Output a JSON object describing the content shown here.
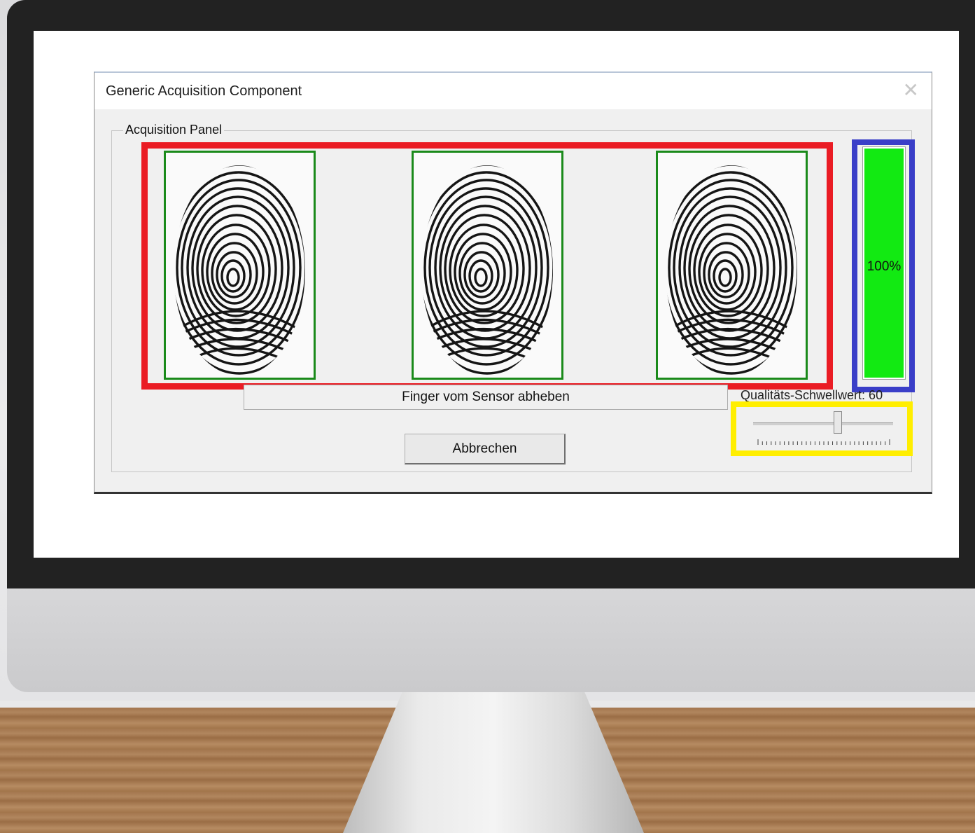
{
  "window": {
    "title": "Generic Acquisition Component",
    "close_icon": "close-icon"
  },
  "panel": {
    "label": "Acquisition Panel",
    "images": [
      {
        "name": "fingerprint-image-1",
        "icon": "fingerprint"
      },
      {
        "name": "fingerprint-image-2",
        "icon": "fingerprint"
      },
      {
        "name": "fingerprint-image-3",
        "icon": "fingerprint"
      }
    ],
    "quality": {
      "value": 100,
      "label": "100%",
      "fill_color": "#12ea12"
    },
    "status_message": "Finger vom Sensor abheben",
    "threshold": {
      "label": "Qualitäts-Schwellwert: 60",
      "value": 60,
      "min": 0,
      "max": 100
    },
    "cancel_label": "Abbrechen"
  },
  "highlights": {
    "images_frame_color": "#ea1c24",
    "quality_frame_color": "#3a3ec8",
    "slider_frame_color": "#ffee00",
    "image_border_color": "#1a8a1a"
  }
}
